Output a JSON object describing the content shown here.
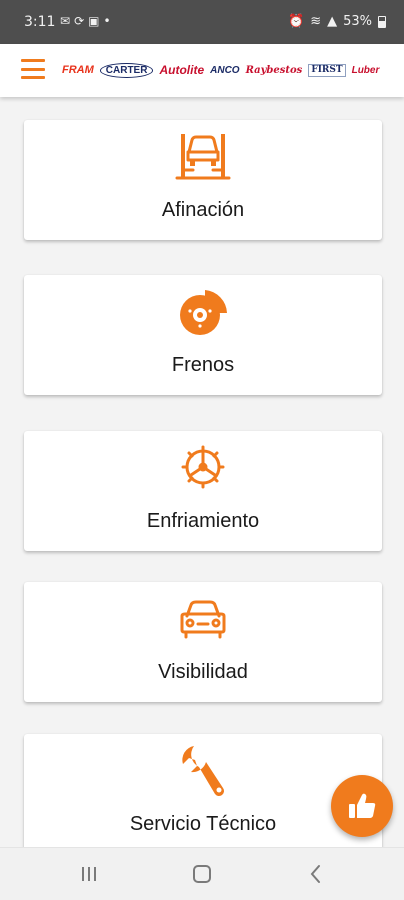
{
  "status_bar": {
    "time": "3:11",
    "left_icons": [
      "email-icon",
      "sync-icon",
      "image-icon",
      "dot-icon"
    ],
    "right_icons": [
      "alarm-icon",
      "wifi-icon",
      "signal-icon"
    ],
    "battery": "53%"
  },
  "header": {
    "menu_icon": "hamburger-icon",
    "brands": [
      "FRAM",
      "CARTER",
      "Autolite",
      "ANCO",
      "Raybestos",
      "FIRST",
      "Luber"
    ]
  },
  "categories": [
    {
      "label": "Afinación",
      "icon": "car-lift-icon"
    },
    {
      "label": "Frenos",
      "icon": "brake-disc-icon"
    },
    {
      "label": "Enfriamiento",
      "icon": "cooling-fan-icon"
    },
    {
      "label": "Visibilidad",
      "icon": "car-front-icon"
    },
    {
      "label": "Servicio Técnico",
      "icon": "wrench-icon"
    }
  ],
  "fab": {
    "icon": "thumbs-up-icon"
  },
  "nav_bar": {
    "icons": [
      "recent-apps-icon",
      "home-icon",
      "back-icon"
    ]
  },
  "colors": {
    "accent": "#f07b1d",
    "status_bar": "#4e4e4e",
    "background": "#f3f3f3"
  }
}
